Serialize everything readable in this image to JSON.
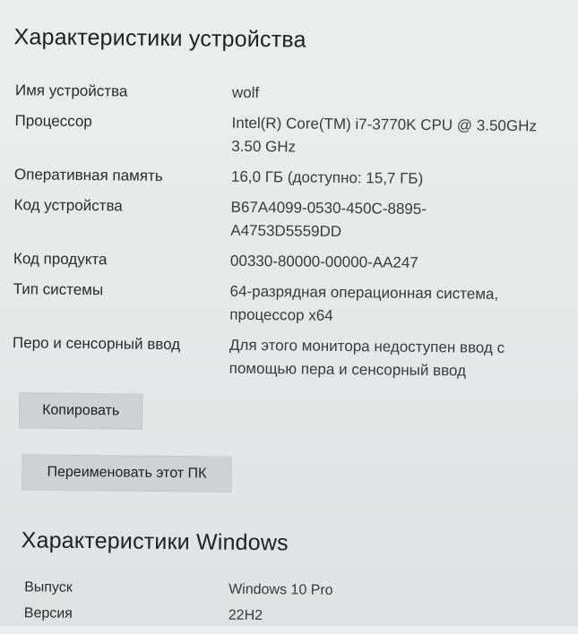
{
  "device_section": {
    "title": "Характеристики устройства",
    "rows": [
      {
        "label": "Имя устройства",
        "value": [
          "wolf"
        ]
      },
      {
        "label": "Процессор",
        "value": [
          "Intel(R) Core(TM) i7-3770K CPU @ 3.50GHz",
          "3.50 GHz"
        ]
      },
      {
        "label": "Оперативная память",
        "value": [
          "16,0 ГБ (доступно: 15,7 ГБ)"
        ]
      },
      {
        "label": "Код устройства",
        "value": [
          "B67A4099-0530-450C-8895-",
          "A4753D5559DD"
        ]
      },
      {
        "label": "Код продукта",
        "value": [
          "00330-80000-00000-AA247"
        ]
      },
      {
        "label": "Тип системы",
        "value": [
          "64-разрядная операционная система,",
          "процессор x64"
        ]
      },
      {
        "label": "Перо и сенсорный ввод",
        "value": [
          "Для этого монитора недоступен ввод с",
          "помощью пера и сенсорный ввод"
        ]
      }
    ],
    "copy_button": "Копировать",
    "rename_button": "Переименовать этот ПК"
  },
  "windows_section": {
    "title": "Характеристики Windows",
    "rows": [
      {
        "label": "Выпуск",
        "value": [
          "Windows 10 Pro"
        ]
      },
      {
        "label": "Версия",
        "value": [
          "22H2"
        ]
      }
    ]
  }
}
